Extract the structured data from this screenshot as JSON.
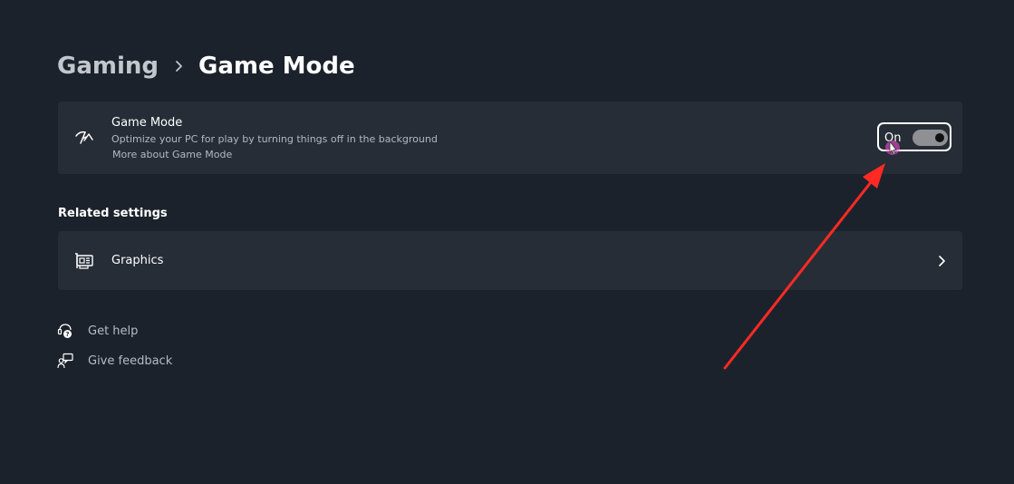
{
  "breadcrumb": {
    "parent": "Gaming",
    "current": "Game Mode"
  },
  "game_mode": {
    "icon": "game-mode-icon",
    "title": "Game Mode",
    "description": "Optimize your PC for play by turning things off in the background",
    "link": "More about Game Mode",
    "toggle_label": "On",
    "toggle_state": true
  },
  "related_settings": {
    "heading": "Related settings",
    "graphics": {
      "icon": "graphics-card-icon",
      "label": "Graphics"
    }
  },
  "help": {
    "get_help": "Get help",
    "give_feedback": "Give feedback"
  },
  "colors": {
    "background": "#1c222b",
    "card": "#262d36",
    "annotation_arrow": "#ff2a24",
    "cursor_highlight": "#ff4fd8"
  }
}
